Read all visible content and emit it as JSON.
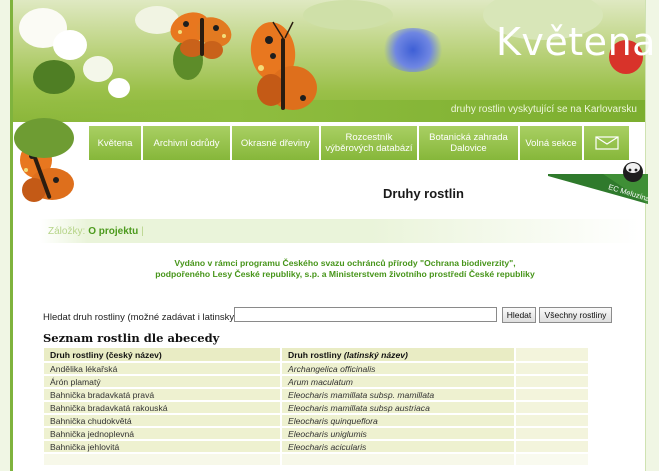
{
  "header": {
    "logo_text": "Květena",
    "tagline": "druhy rostlin vyskytující se na Karlovarsku"
  },
  "nav": {
    "items": [
      {
        "label": "Květena"
      },
      {
        "label": "Archivní odrůdy"
      },
      {
        "label": "Okrasné dřeviny"
      },
      {
        "label": "Rozcestník výběrových databází"
      },
      {
        "label": "Botanická zahrada Dalovice"
      },
      {
        "label": "Volná sekce"
      }
    ],
    "envelope_icon": "envelope-icon"
  },
  "page_title": "Druhy rostlin",
  "badge": {
    "text": "EC Meluzína"
  },
  "bookmarks": {
    "label": "Záložky:",
    "link": "O projektu",
    "separator": "|"
  },
  "notice": {
    "line1": "Vydáno v rámci programu Českého svazu ochránců přírody \"Ochrana biodiverzity\",",
    "line2": "podpořeného Lesy České republiky, s.p. a Ministerstvem životního prostředí České republiky"
  },
  "search": {
    "label": "Hledat druh rostliny (možné zadávat i latinsky):",
    "value": "",
    "search_button": "Hledat",
    "all_button": "Všechny rostliny"
  },
  "list": {
    "heading": "Seznam rostlin dle abecedy",
    "col_czech": "Druh rostliny (český název)",
    "col_latin_prefix": "Druh rostliny ",
    "col_latin_italic": "(latinský název)",
    "rows": [
      {
        "czech": "Andělika lékařská",
        "latin": "Archangelica officinalis"
      },
      {
        "czech": "Árón plamatý",
        "latin": "Arum maculatum"
      },
      {
        "czech": "Bahnička bradavkatá pravá",
        "latin": "Eleocharis mamillata subsp. mamillata"
      },
      {
        "czech": "Bahnička bradavkatá rakouská",
        "latin": "Eleocharis mamillata subsp austriaca"
      },
      {
        "czech": "Bahnička chudokvětá",
        "latin": "Eleocharis quinqueflora"
      },
      {
        "czech": "Bahnička jednoplevná",
        "latin": "Eleocharis uniglumis"
      },
      {
        "czech": "Bahnička jehlovitá",
        "latin": "Eleocharis acicularis"
      },
      {
        "czech": "",
        "latin": ""
      }
    ]
  },
  "colors": {
    "accent_green": "#7fb33d",
    "link_green": "#4c9a1d",
    "table_bg": "#eef1d0"
  }
}
